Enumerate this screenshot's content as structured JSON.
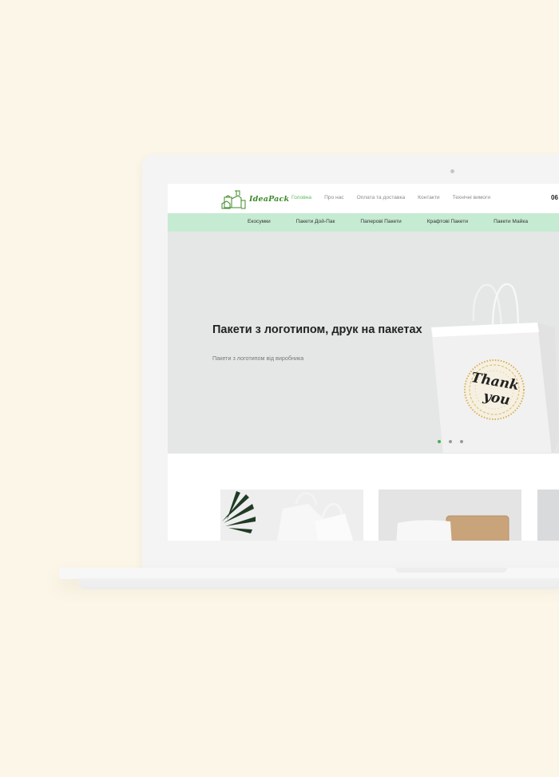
{
  "site": {
    "brand": "IdeaPack",
    "nav": [
      {
        "label": "Головна"
      },
      {
        "label": "Про нас"
      },
      {
        "label": "Оплата та доставка"
      },
      {
        "label": "Контакти"
      },
      {
        "label": "Технічні вимоги"
      }
    ],
    "phone": "06",
    "categories": [
      {
        "label": "Екосумки"
      },
      {
        "label": "Пакети Дой-Пак"
      },
      {
        "label": "Паперові Пакети"
      },
      {
        "label": "Крафтові Пакети"
      },
      {
        "label": "Пакети Майка"
      }
    ]
  },
  "hero": {
    "title": "Пакети з логотипом, друк на пакетах",
    "subtitle": "Пакети з логотипом від виробника",
    "slides_total": 3,
    "slide_active": 1
  },
  "colors": {
    "page_background": "#fcf6e8",
    "category_bar": "#c6ebd3",
    "accent_green": "#5cb85c",
    "hero_background": "#e5e7e7"
  },
  "icons": [
    "logo-bags-icon"
  ]
}
